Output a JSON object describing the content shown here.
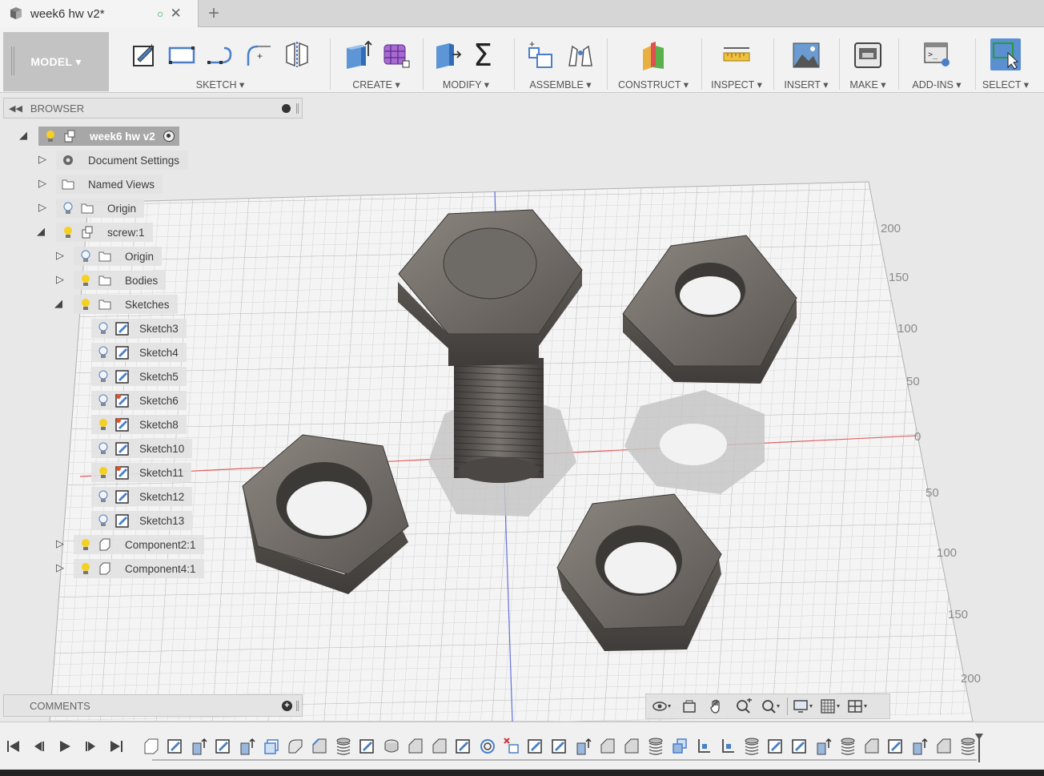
{
  "tab": {
    "title": "week6 hw v2*",
    "status_icon": "○",
    "close_icon": "✕",
    "new_tab_icon": "+"
  },
  "toolbar": {
    "workspace": "MODEL ▾",
    "groups": [
      {
        "label": "SKETCH ▾",
        "icons": [
          "create-sketch-icon",
          "rectangle-icon",
          "line-icon",
          "fillet-sketch-icon",
          "mirror-icon"
        ]
      },
      {
        "label": "CREATE ▾",
        "icons": [
          "extrude-box-icon",
          "form-icon"
        ]
      },
      {
        "label": "MODIFY ▾",
        "icons": [
          "press-pull-icon",
          "sigma-icon"
        ]
      },
      {
        "label": "ASSEMBLE ▾",
        "icons": [
          "new-component-icon",
          "joint-icon"
        ]
      },
      {
        "label": "CONSTRUCT ▾",
        "icons": [
          "plane-icon"
        ]
      },
      {
        "label": "INSPECT ▾",
        "icons": [
          "measure-icon"
        ]
      },
      {
        "label": "INSERT ▾",
        "icons": [
          "image-icon"
        ]
      },
      {
        "label": "MAKE ▾",
        "icons": [
          "3d-print-icon"
        ]
      },
      {
        "label": "ADD-INS ▾",
        "icons": [
          "scripts-icon"
        ]
      },
      {
        "label": "SELECT ▾",
        "icons": [
          "select-icon"
        ]
      }
    ]
  },
  "browser": {
    "title": "BROWSER",
    "root": "week6 hw v2",
    "items": [
      {
        "label": "Document Settings"
      },
      {
        "label": "Named Views"
      },
      {
        "label": "Origin"
      },
      {
        "label": "screw:1"
      },
      {
        "label": "Origin"
      },
      {
        "label": "Bodies"
      },
      {
        "label": "Sketches"
      },
      {
        "label": "Sketch3"
      },
      {
        "label": "Sketch4"
      },
      {
        "label": "Sketch5"
      },
      {
        "label": "Sketch6"
      },
      {
        "label": "Sketch8"
      },
      {
        "label": "Sketch10"
      },
      {
        "label": "Sketch11"
      },
      {
        "label": "Sketch12"
      },
      {
        "label": "Sketch13"
      },
      {
        "label": "Component2:1"
      },
      {
        "label": "Component4:1"
      }
    ]
  },
  "comments": {
    "title": "COMMENTS"
  },
  "axis_labels": [
    "200",
    "150",
    "100",
    "50",
    "0",
    "50",
    "100",
    "150",
    "200"
  ],
  "colors": {
    "accent": "#5a8fd0",
    "x_axis": "#e06060",
    "y_axis": "#6070e0",
    "metal": "#6b6762"
  }
}
